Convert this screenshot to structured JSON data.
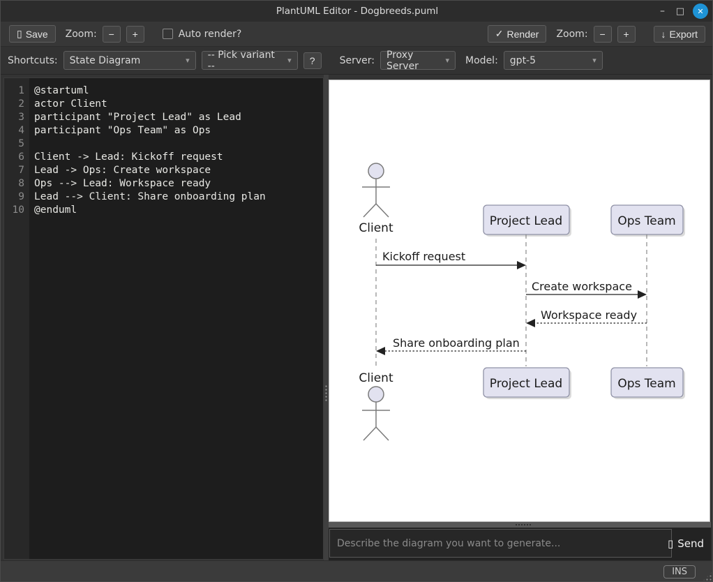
{
  "window": {
    "title": "PlantUML Editor - Dogbreeds.puml",
    "controls": {
      "minimize": "–",
      "maximize": "□",
      "close": "✕"
    }
  },
  "toolbar": {
    "save_icon": "▯",
    "save_label": "Save",
    "zoom_label_left": "Zoom:",
    "zoom_out_label": "−",
    "zoom_in_label": "+",
    "auto_render_label": "Auto render?",
    "auto_render_checked": false,
    "render_icon": "✓",
    "render_label": "Render",
    "zoom_label_right": "Zoom:",
    "zoom_out_right_label": "−",
    "zoom_in_right_label": "+",
    "export_icon": "↓",
    "export_label": "Export"
  },
  "shortcuts": {
    "label": "Shortcuts:",
    "diagram_type_value": "State Diagram",
    "variant_value": "-- Pick variant --",
    "help_label": "?",
    "server_label": "Server:",
    "server_value": "Proxy Server",
    "model_label": "Model:",
    "model_value": "gpt-5",
    "caret": "▾"
  },
  "editor": {
    "lines": [
      {
        "num": "1",
        "code": "@startuml"
      },
      {
        "num": "2",
        "code": "actor Client"
      },
      {
        "num": "3",
        "code": "participant \"Project Lead\" as Lead"
      },
      {
        "num": "4",
        "code": "participant \"Ops Team\" as Ops"
      },
      {
        "num": "5",
        "code": ""
      },
      {
        "num": "6",
        "code": "Client -> Lead: Kickoff request"
      },
      {
        "num": "7",
        "code": "Lead -> Ops: Create workspace"
      },
      {
        "num": "8",
        "code": "Ops --> Lead: Workspace ready"
      },
      {
        "num": "9",
        "code": "Lead --> Client: Share onboarding plan"
      },
      {
        "num": "10",
        "code": "@enduml"
      }
    ]
  },
  "diagram": {
    "participants": {
      "client": "Client",
      "lead": "Project Lead",
      "ops": "Ops Team"
    },
    "messages": [
      {
        "label": "Kickoff request",
        "from": "Client",
        "to": "Lead",
        "style": "solid"
      },
      {
        "label": "Create workspace",
        "from": "Lead",
        "to": "Ops",
        "style": "solid"
      },
      {
        "label": "Workspace ready",
        "from": "Ops",
        "to": "Lead",
        "style": "dashed"
      },
      {
        "label": "Share onboarding plan",
        "from": "Lead",
        "to": "Client",
        "style": "dashed"
      }
    ],
    "colors": {
      "participant_fill": "#E2E2F0",
      "participant_border": "#9092A6",
      "lifeline": "#888888",
      "arrow": "#222222",
      "text": "#1A1A1A",
      "canvas": "#FFFFFF"
    }
  },
  "prompt": {
    "placeholder": "Describe the diagram you want to generate...",
    "send_icon": "▯",
    "send_label": "Send"
  },
  "statusbar": {
    "mode": "INS"
  }
}
